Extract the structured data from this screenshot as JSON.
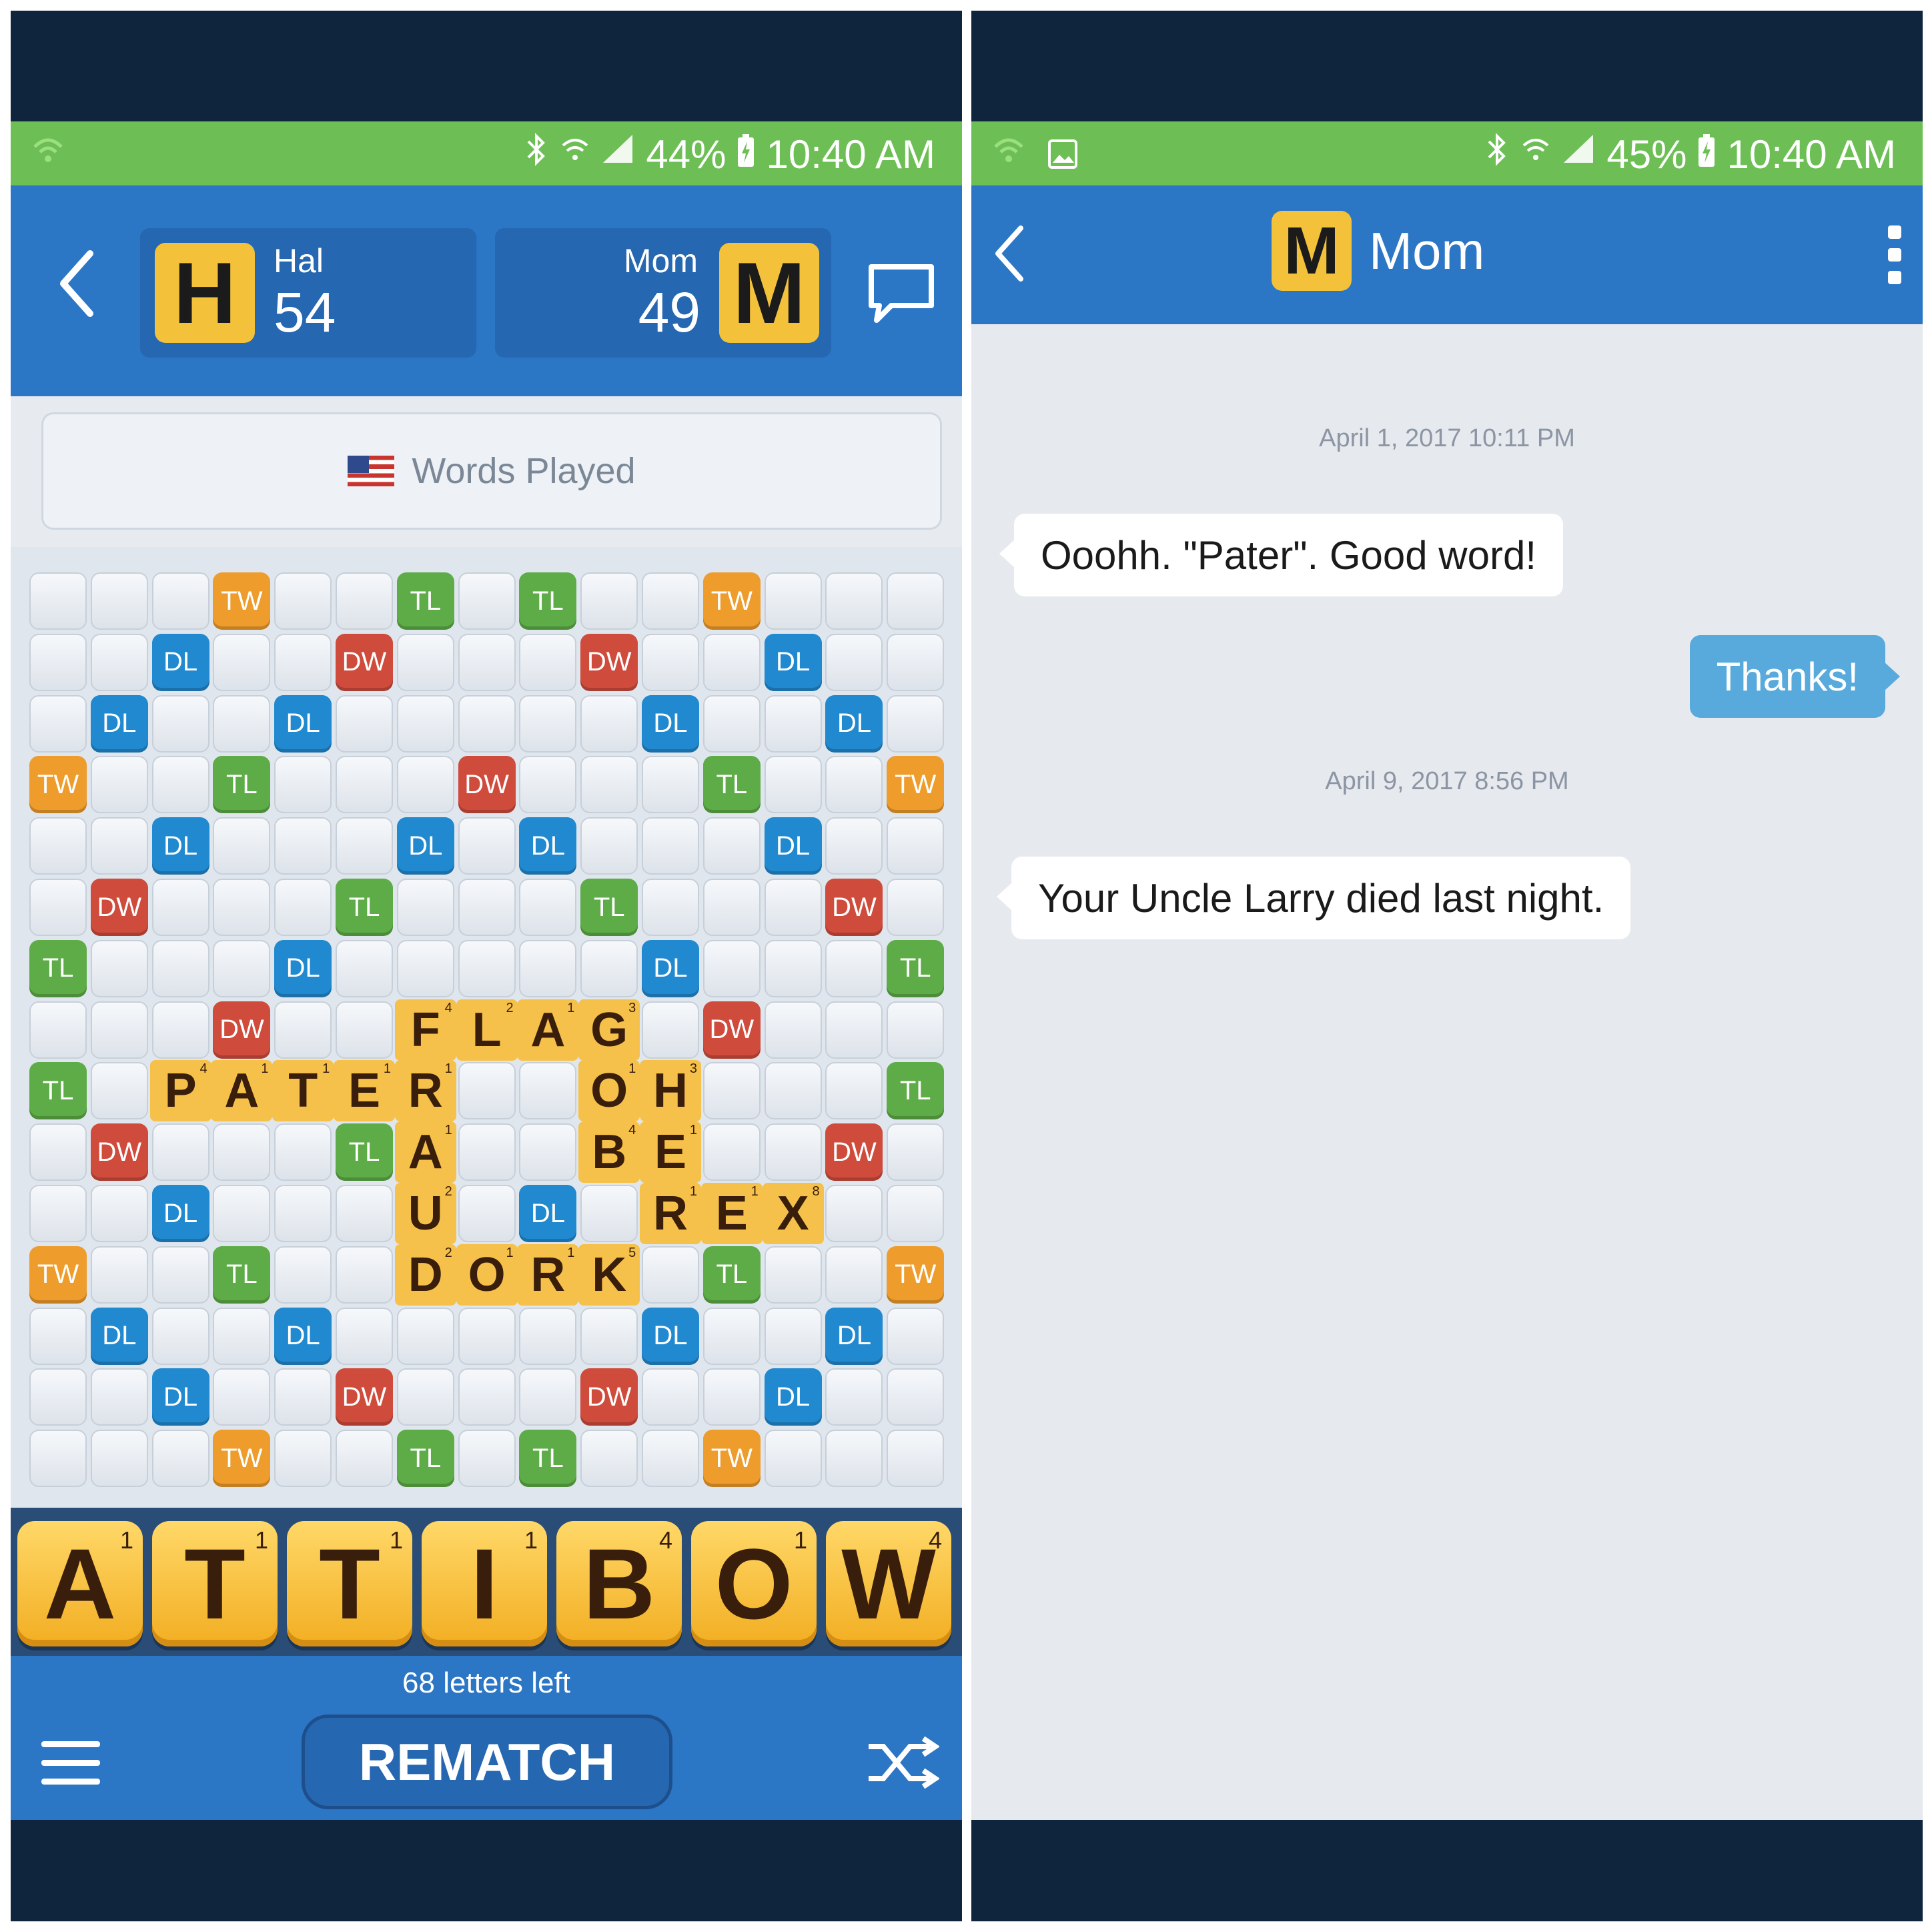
{
  "colors": {
    "status_bar": "#6dbf55",
    "app_bar": "#2b76c5",
    "badge": "#f3c23a",
    "tw": "#ee9c2b",
    "tl": "#5eac47",
    "dl": "#2189cf",
    "dw": "#cf4b3c",
    "tile": "#f6c14a",
    "bubble_out": "#58aadc"
  },
  "game": {
    "status": {
      "battery": "44%",
      "time": "10:40 AM",
      "icons": [
        "wifi-calling-icon",
        "bluetooth-icon",
        "wifi-icon",
        "signal-icon",
        "battery-charging-icon"
      ]
    },
    "players": [
      {
        "initial": "H",
        "name": "Hal",
        "score": "54"
      },
      {
        "initial": "M",
        "name": "Mom",
        "score": "49"
      }
    ],
    "words_played_label": "Words Played",
    "board_rows": [
      "...TW..TL.TL..TW...",
      "..DL..DW...DW..DL..",
      ".DL..DL...DL..DL.",
      "TW..TL...DW...TL..TW",
      "..DL...DL.DL...DL..",
      ".DW...TL...TL...DW.",
      "TL...DL...DL...TL",
      "...DW.........DW...",
      "TL.............TL",
      ".DW...TL......DW.",
      "..DL.....DL.......",
      "TW..TL.......TL..TW",
      ".DL..DL...DL..DL.",
      "..DL..DW...DW..DL..",
      "...TW..TL.TL..TW..."
    ],
    "premium_squares": [
      [
        0,
        3,
        "TW"
      ],
      [
        0,
        6,
        "TL"
      ],
      [
        0,
        8,
        "TL"
      ],
      [
        0,
        11,
        "TW"
      ],
      [
        1,
        2,
        "DL"
      ],
      [
        1,
        5,
        "DW"
      ],
      [
        1,
        9,
        "DW"
      ],
      [
        1,
        12,
        "DL"
      ],
      [
        2,
        1,
        "DL"
      ],
      [
        2,
        4,
        "DL"
      ],
      [
        2,
        10,
        "DL"
      ],
      [
        2,
        13,
        "DL"
      ],
      [
        3,
        0,
        "TW"
      ],
      [
        3,
        3,
        "TL"
      ],
      [
        3,
        7,
        "DW"
      ],
      [
        3,
        11,
        "TL"
      ],
      [
        3,
        14,
        "TW"
      ],
      [
        4,
        2,
        "DL"
      ],
      [
        4,
        6,
        "DL"
      ],
      [
        4,
        8,
        "DL"
      ],
      [
        4,
        12,
        "DL"
      ],
      [
        5,
        1,
        "DW"
      ],
      [
        5,
        5,
        "TL"
      ],
      [
        5,
        9,
        "TL"
      ],
      [
        5,
        13,
        "DW"
      ],
      [
        6,
        0,
        "TL"
      ],
      [
        6,
        4,
        "DL"
      ],
      [
        6,
        10,
        "DL"
      ],
      [
        6,
        14,
        "TL"
      ],
      [
        7,
        3,
        "DW"
      ],
      [
        7,
        11,
        "DW"
      ],
      [
        8,
        0,
        "TL"
      ],
      [
        8,
        14,
        "TL"
      ],
      [
        9,
        1,
        "DW"
      ],
      [
        9,
        5,
        "TL"
      ],
      [
        9,
        13,
        "DW"
      ],
      [
        10,
        2,
        "DL"
      ],
      [
        10,
        8,
        "DL"
      ],
      [
        11,
        0,
        "TW"
      ],
      [
        11,
        3,
        "TL"
      ],
      [
        11,
        11,
        "TL"
      ],
      [
        11,
        14,
        "TW"
      ],
      [
        12,
        1,
        "DL"
      ],
      [
        12,
        4,
        "DL"
      ],
      [
        12,
        10,
        "DL"
      ],
      [
        12,
        13,
        "DL"
      ],
      [
        13,
        2,
        "DL"
      ],
      [
        13,
        5,
        "DW"
      ],
      [
        13,
        9,
        "DW"
      ],
      [
        13,
        12,
        "DL"
      ],
      [
        14,
        3,
        "TW"
      ],
      [
        14,
        6,
        "TL"
      ],
      [
        14,
        8,
        "TL"
      ],
      [
        14,
        11,
        "TW"
      ]
    ],
    "placed_tiles": [
      [
        7,
        6,
        "F",
        "4"
      ],
      [
        7,
        7,
        "L",
        "2"
      ],
      [
        7,
        8,
        "A",
        "1"
      ],
      [
        7,
        9,
        "G",
        "3"
      ],
      [
        8,
        2,
        "P",
        "4"
      ],
      [
        8,
        3,
        "A",
        "1"
      ],
      [
        8,
        4,
        "T",
        "1"
      ],
      [
        8,
        5,
        "E",
        "1"
      ],
      [
        8,
        6,
        "R",
        "1"
      ],
      [
        8,
        9,
        "O",
        "1"
      ],
      [
        8,
        10,
        "H",
        "3"
      ],
      [
        9,
        6,
        "A",
        "1"
      ],
      [
        9,
        9,
        "B",
        "4"
      ],
      [
        9,
        10,
        "E",
        "1"
      ],
      [
        10,
        6,
        "U",
        "2"
      ],
      [
        10,
        10,
        "R",
        "1"
      ],
      [
        10,
        11,
        "E",
        "1"
      ],
      [
        10,
        12,
        "X",
        "8"
      ],
      [
        11,
        6,
        "D",
        "2"
      ],
      [
        11,
        7,
        "O",
        "1"
      ],
      [
        11,
        8,
        "R",
        "1"
      ],
      [
        11,
        9,
        "K",
        "5"
      ]
    ],
    "rack": [
      {
        "letter": "A",
        "points": "1"
      },
      {
        "letter": "T",
        "points": "1"
      },
      {
        "letter": "T",
        "points": "1"
      },
      {
        "letter": "I",
        "points": "1"
      },
      {
        "letter": "B",
        "points": "4"
      },
      {
        "letter": "O",
        "points": "1"
      },
      {
        "letter": "W",
        "points": "4"
      }
    ],
    "letters_left": "68 letters left",
    "rematch_label": "REMATCH"
  },
  "chat": {
    "status": {
      "battery": "45%",
      "time": "10:40 AM",
      "icons": [
        "wifi-calling-icon",
        "image-icon",
        "bluetooth-icon",
        "wifi-icon",
        "signal-icon",
        "battery-charging-icon"
      ]
    },
    "contact": {
      "initial": "M",
      "name": "Mom"
    },
    "timestamps": [
      "April 1, 2017 10:11 PM",
      "April 9, 2017 8:56 PM"
    ],
    "messages": [
      {
        "direction": "in",
        "text": "Ooohh. \"Pater\". Good word!"
      },
      {
        "direction": "out",
        "text": "Thanks!"
      },
      {
        "direction": "in",
        "text": "Your Uncle Larry died last night."
      }
    ]
  }
}
